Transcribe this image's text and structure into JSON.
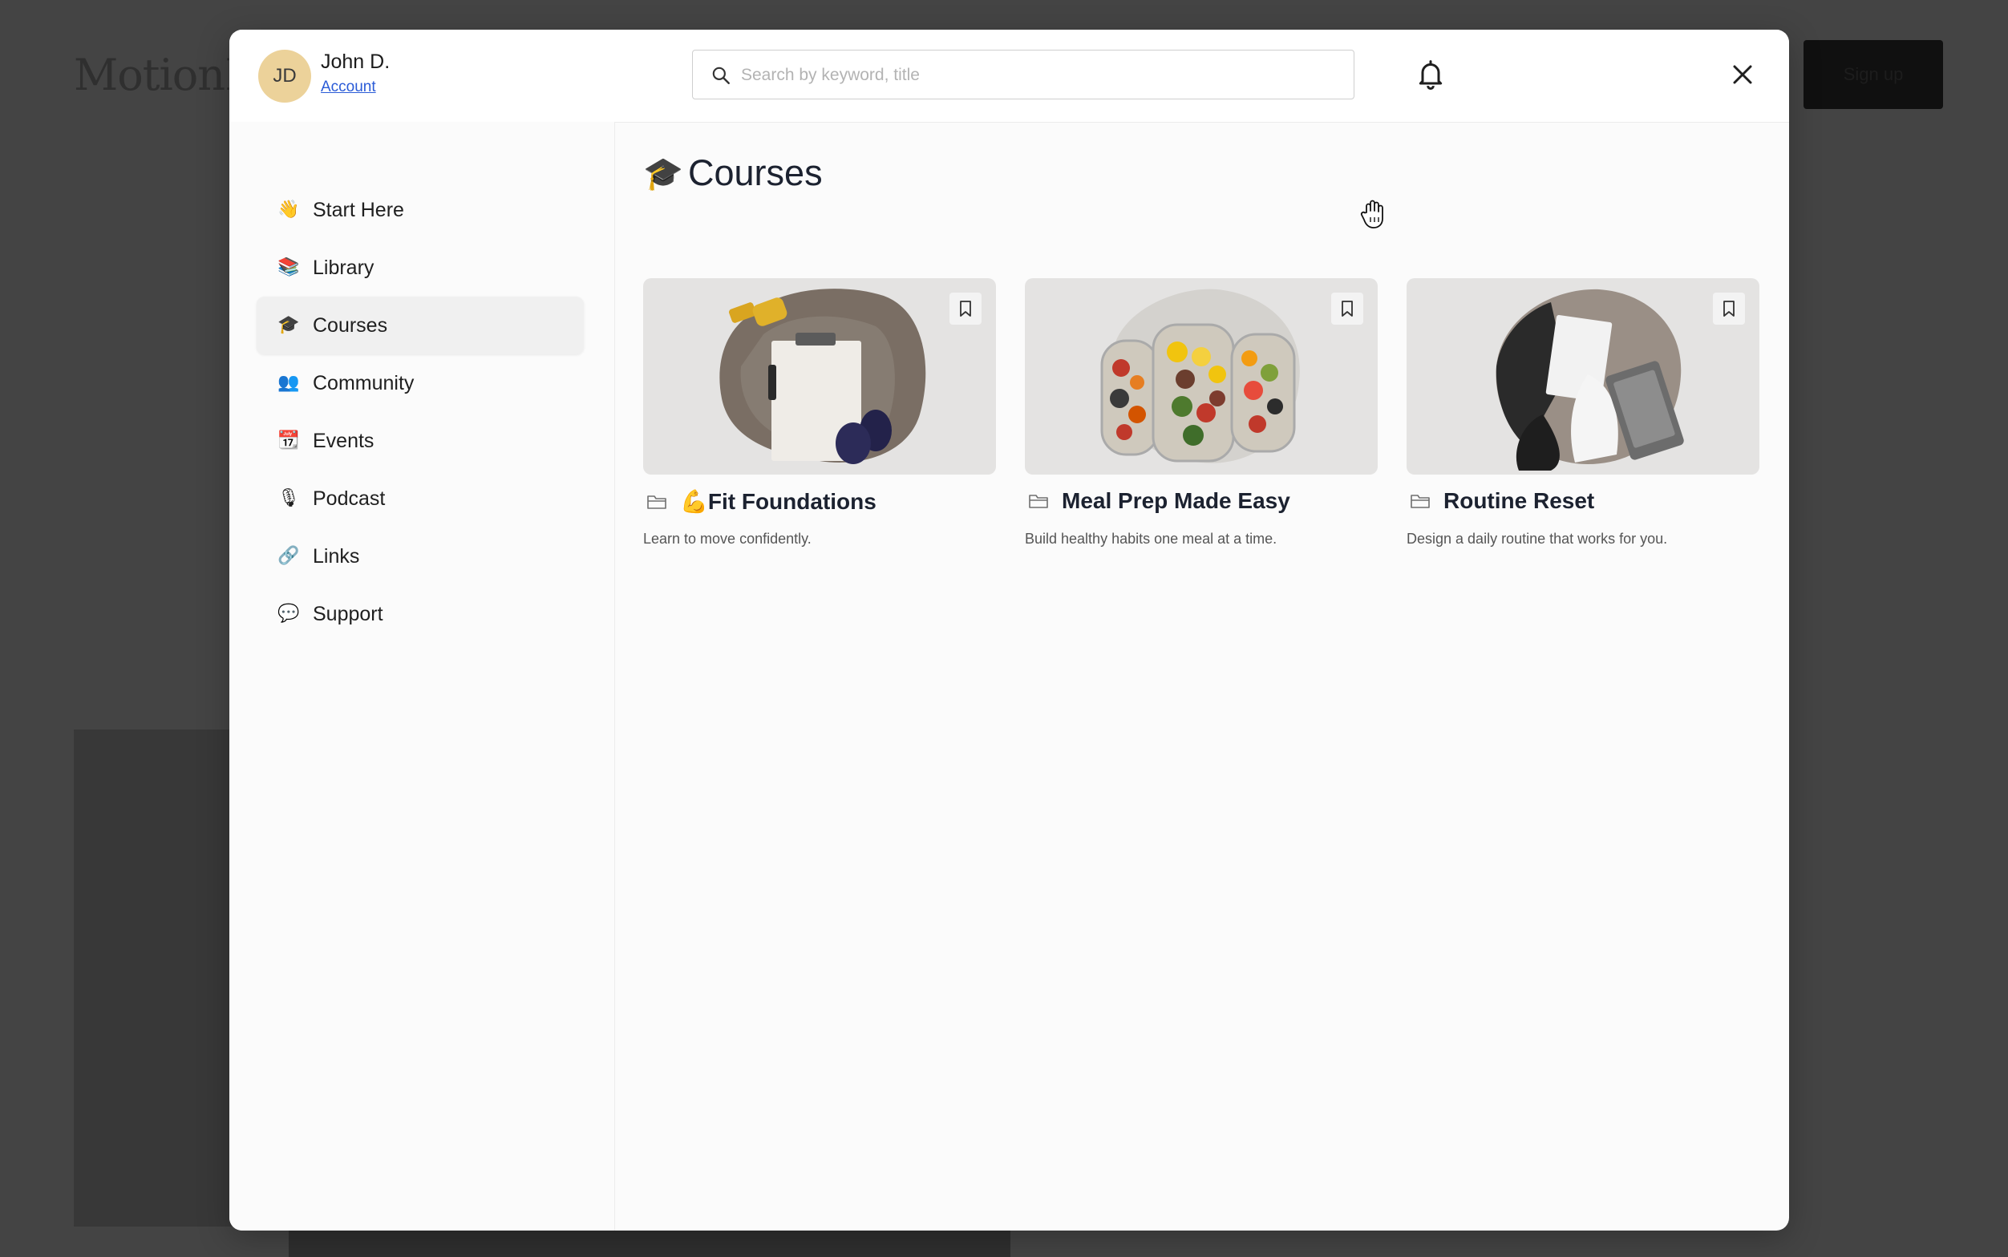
{
  "background_page": {
    "logo_text": "MotionL",
    "signup_label": "Sign up"
  },
  "header": {
    "user": {
      "initials": "JD",
      "name": "John D.",
      "account_link": "Account",
      "avatar_color": "#ecd29a"
    },
    "search": {
      "placeholder": "Search by keyword, title",
      "value": ""
    },
    "notifications_icon": "bell-icon",
    "close_icon": "close-icon"
  },
  "sidebar": {
    "active": "Courses",
    "items": [
      {
        "emoji": "👋",
        "label": "Start Here"
      },
      {
        "emoji": "📚",
        "label": "Library"
      },
      {
        "emoji": "🎓",
        "label": "Courses"
      },
      {
        "emoji": "👥",
        "label": "Community"
      },
      {
        "emoji": "📆",
        "label": "Events"
      },
      {
        "emoji": "🎙",
        "label": "Podcast"
      },
      {
        "emoji": "🔗",
        "label": "Links"
      },
      {
        "emoji": "💬",
        "label": "Support"
      }
    ]
  },
  "main": {
    "title_emoji": "🎓",
    "title": "Courses",
    "courses": [
      {
        "title": "💪Fit Foundations",
        "description": "Learn to move confidently.",
        "image": "clipboard-and-dumbbells"
      },
      {
        "title": "Meal Prep Made Easy",
        "description": "Build healthy habits one meal at a time.",
        "image": "meal-prep-containers"
      },
      {
        "title": "Routine Reset",
        "description": "Design a daily routine that works for you.",
        "image": "person-writing-with-laptop"
      }
    ]
  },
  "colors": {
    "overlay": "#4a4a4a",
    "modal_bg": "#fbfbfb",
    "link": "#2a5bd7",
    "title_text": "#1c2230"
  }
}
